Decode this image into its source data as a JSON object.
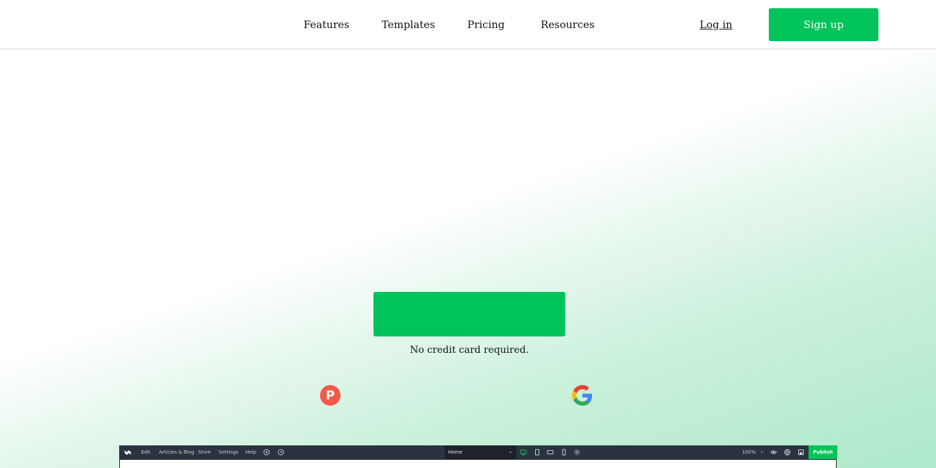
{
  "nav": {
    "links": [
      "Features",
      "Templates",
      "Pricing",
      "Resources"
    ],
    "login_label": "Log in",
    "signup_label": "Sign up"
  },
  "hero": {
    "cta_note": "No credit card required."
  },
  "badges": {
    "producthunt_letter": "P"
  },
  "editor": {
    "menu": [
      "Edit",
      "Articles & Blog",
      "Store",
      "Settings",
      "Help"
    ],
    "page_select": "Home",
    "zoom": "100%",
    "publish_label": "Publish"
  },
  "colors": {
    "brand_green": "#00c45a",
    "editor_bar": "#2c3340",
    "producthunt": "#f15a49"
  }
}
